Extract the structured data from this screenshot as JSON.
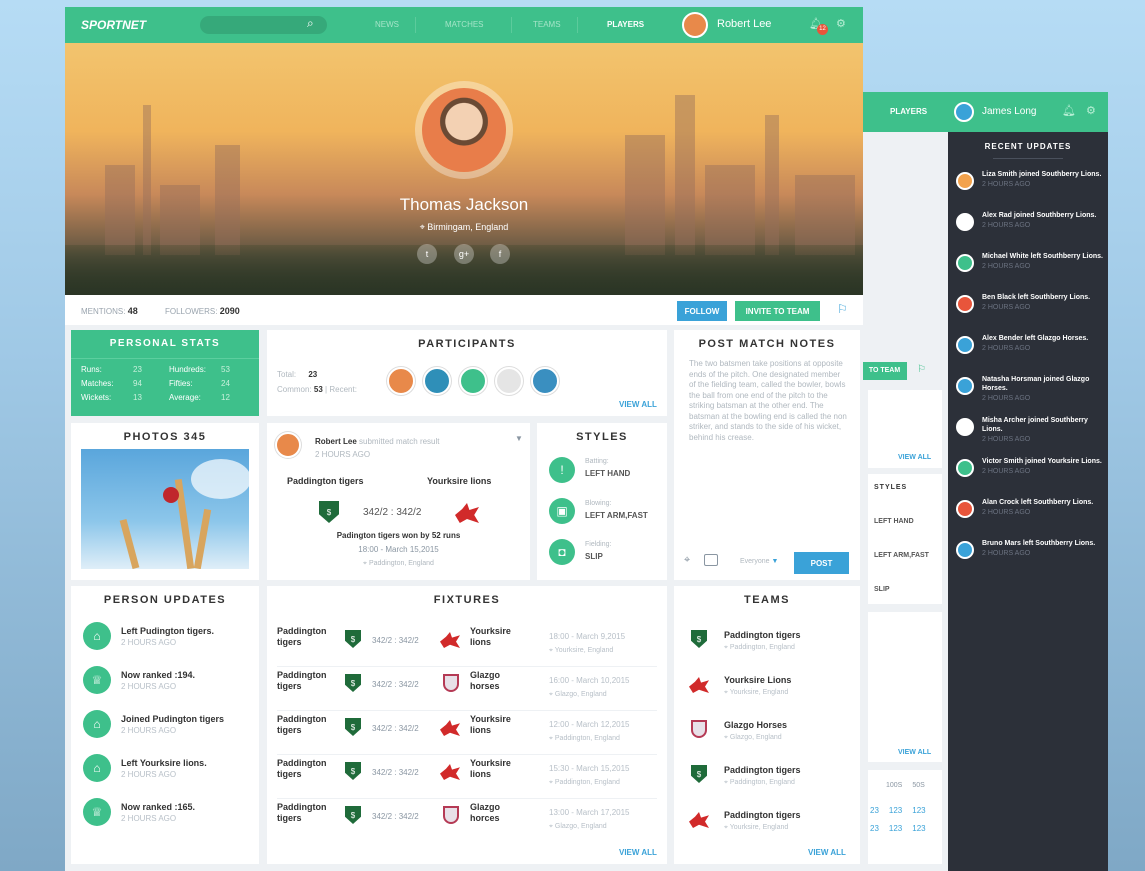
{
  "back": {
    "nav_players": "PLAYERS",
    "user_name": "James Long",
    "recent_title": "RECENT UPDATES",
    "updates": [
      {
        "text": "Liza Smith joined Southberry Lions.",
        "time": "2 HOURS AGO",
        "color": "#f3a24c"
      },
      {
        "text": "Alex Rad joined Southberry Lions.",
        "time": "2 HOURS AGO",
        "color": "#ffffff"
      },
      {
        "text": "Michael White left Southberry Lions.",
        "time": "2 HOURS AGO",
        "color": "#3ec08b"
      },
      {
        "text": "Ben Black left Southberry Lions.",
        "time": "2 HOURS AGO",
        "color": "#e8553b"
      },
      {
        "text": "Alex Bender left Glazgo Horses.",
        "time": "2 HOURS AGO",
        "color": "#3aa2d8"
      },
      {
        "text": "Natasha Horsman joined Glazgo Horses.",
        "time": "2 HOURS AGO",
        "color": "#3aa2d8"
      },
      {
        "text": "Misha Archer joined Southberry Lions.",
        "time": "2 HOURS AGO",
        "color": "#ffffff"
      },
      {
        "text": "Victor Smith joined Yourksire Lions.",
        "time": "2 HOURS AGO",
        "color": "#3ec08b"
      },
      {
        "text": "Alan Crock left Southberry Lions.",
        "time": "2 HOURS AGO",
        "color": "#e8553b"
      },
      {
        "text": "Bruno Mars left Southberry Lions.",
        "time": "2 HOURS AGO",
        "color": "#3aa2d8"
      }
    ],
    "invite_partial": "TO TEAM",
    "view_all": "VIEW ALL",
    "styles": "STYLES",
    "batting_value": "LEFT HAND",
    "bowling_value": "LEFT ARM,FAST",
    "fielding_value": "SLIP",
    "stats_cols": [
      "100S",
      "50S"
    ],
    "stats_rows": [
      [
        "23",
        "123",
        "123"
      ],
      [
        "23",
        "123",
        "123"
      ]
    ]
  },
  "nav": {
    "logo": "SPORTNET",
    "items": [
      "NEWS",
      "MATCHES",
      "TEAMS",
      "PLAYERS"
    ],
    "user_name": "Robert Lee",
    "notif_count": "12"
  },
  "profile": {
    "name": "Thomas Jackson",
    "location": "Birmingam, England"
  },
  "stats_bar": {
    "mentions_label": "MENTIONS:",
    "mentions": "48",
    "followers_label": "FOLLOWERS:",
    "followers": "2090",
    "follow": "FOLLOW",
    "invite": "INVITE TO TEAM"
  },
  "personal_stats": {
    "title": "PERSONAL STATS",
    "rows": [
      {
        "l1": "Runs:",
        "v1": "23",
        "l2": "Hundreds:",
        "v2": "53"
      },
      {
        "l1": "Matches:",
        "v1": "94",
        "l2": "Fifties:",
        "v2": "24"
      },
      {
        "l1": "Wickets:",
        "v1": "13",
        "l2": "Average:",
        "v2": "12"
      }
    ]
  },
  "participants": {
    "title": "PARTICIPANTS",
    "total_label": "Total:",
    "total": "23",
    "common_label": "Common:",
    "common": "53",
    "recent_label": "Recent:",
    "view_all": "VIEW ALL",
    "avatars": [
      "#e8894a",
      "#2f8fb8",
      "#3ec08b",
      "#e5e5e5",
      "#3a8fc0"
    ]
  },
  "post_notes": {
    "title": "POST MATCH NOTES",
    "text": "The two batsmen take positions at opposite ends of the pitch. One designated member of the fielding team, called the bowler, bowls the ball from one end of the pitch to the striking batsman at the other end. The batsman at the bowling end is called the non striker, and stands to the side of his wicket, behind his crease.",
    "audience": "Everyone",
    "post": "POST"
  },
  "photos": {
    "title": "PHOTOS 345"
  },
  "match": {
    "user": "Robert Lee",
    "action": "submitted match result",
    "time": "2 HOURS AGO",
    "team_a": "Paddington tigers",
    "team_b": "Yourksire lions",
    "score": "342/2 : 342/2",
    "result": "Padington tigers won by 52 runs",
    "datetime": "18:00 - March 15,2015",
    "location": "Paddington, England"
  },
  "styles": {
    "title": "STYLES",
    "batting_label": "Batting:",
    "batting": "LEFT HAND",
    "bowling_label": "Blowing:",
    "bowling": "LEFT ARM,FAST",
    "fielding_label": "Fielding:",
    "fielding": "SLIP"
  },
  "person_updates": {
    "title": "PERSON UPDATES",
    "items": [
      {
        "text": "Left Pudington tigers.",
        "time": "2 HOURS AGO",
        "icon": "A"
      },
      {
        "text": "Now ranked :194.",
        "time": "2 HOURS AGO",
        "icon": "T"
      },
      {
        "text": "Joined Pudington tigers",
        "time": "2 HOURS AGO",
        "icon": "A"
      },
      {
        "text": "Left Yourksire lions.",
        "time": "2 HOURS AGO",
        "icon": "A"
      },
      {
        "text": "Now ranked :165.",
        "time": "2 HOURS AGO",
        "icon": "T"
      }
    ]
  },
  "fixtures": {
    "title": "FIXTURES",
    "view_all": "VIEW ALL",
    "rows": [
      {
        "team_a": "Paddington tigers",
        "score": "342/2 : 342/2",
        "team_b": "Yourksire lions",
        "b_crest": "dragon",
        "datetime": "18:00 - March 9,2015",
        "location": "Yourksire, England"
      },
      {
        "team_a": "Paddington tigers",
        "score": "342/2 : 342/2",
        "team_b": "Glazgo horses",
        "b_crest": "shield",
        "datetime": "16:00 - March 10,2015",
        "location": "Glazgo, England"
      },
      {
        "team_a": "Paddington tigers",
        "score": "342/2 : 342/2",
        "team_b": "Yourksire lions",
        "b_crest": "dragon",
        "datetime": "12:00 - March 12,2015",
        "location": "Paddington, England"
      },
      {
        "team_a": "Paddington tigers",
        "score": "342/2 : 342/2",
        "team_b": "Yourksire lions",
        "b_crest": "dragon",
        "datetime": "15:30 - March 15,2015",
        "location": "Paddington, England"
      },
      {
        "team_a": "Paddington tigers",
        "score": "342/2 : 342/2",
        "team_b": "Glazgo horces",
        "b_crest": "shield",
        "datetime": "13:00 - March 17,2015",
        "location": "Glazgo, England"
      }
    ]
  },
  "teams": {
    "title": "TEAMS",
    "view_all": "VIEW ALL",
    "items": [
      {
        "name": "Paddington tigers",
        "location": "Paddington, England",
        "crest": "tiger"
      },
      {
        "name": "Yourksire Lions",
        "location": "Yourksire, England",
        "crest": "dragon"
      },
      {
        "name": "Glazgo Horses",
        "location": "Glazgo, England",
        "crest": "shield"
      },
      {
        "name": "Paddington tigers",
        "location": "Paddington, England",
        "crest": "tiger"
      },
      {
        "name": "Paddington tigers",
        "location": "Yourksire, England",
        "crest": "dragon"
      }
    ]
  }
}
